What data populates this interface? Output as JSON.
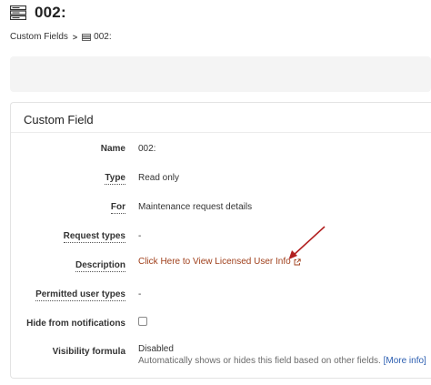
{
  "header": {
    "title": "002:",
    "icon": "server-rack-icon"
  },
  "breadcrumb": {
    "parent_label": "Custom Fields",
    "separator": ">",
    "current_label": "002:",
    "current_icon": "server-rack-icon"
  },
  "card": {
    "title": "Custom Field",
    "rows": [
      {
        "label": "Name",
        "value": "002:"
      },
      {
        "label": "Type",
        "value": "Read only"
      },
      {
        "label": "For",
        "value": "Maintenance request details"
      },
      {
        "label": "Request types",
        "value": "-"
      },
      {
        "label": "Description",
        "value": "Click Here to View Licensed User Info",
        "value_icon": "external-link-icon"
      },
      {
        "label": "Permitted user types",
        "value": "-"
      },
      {
        "label": "Hide from notifications",
        "checked": false
      },
      {
        "label": "Visibility formula",
        "value": "Disabled",
        "help": "Automatically shows or hides this field based on other fields.",
        "help_link": "[More info]"
      }
    ]
  },
  "colors": {
    "link": "#a0401c",
    "more_info_link": "#2a5db0",
    "annotation_arrow": "#b22020",
    "panel_background": "#f4f4f4"
  }
}
